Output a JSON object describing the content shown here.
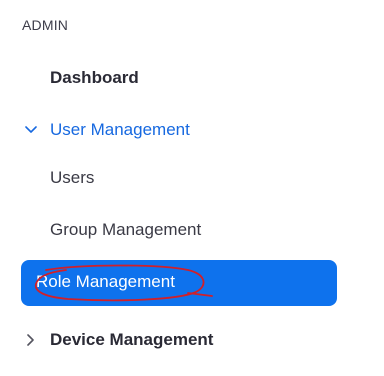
{
  "sidebar": {
    "section_title": "ADMIN",
    "items": [
      {
        "label": "Dashboard"
      },
      {
        "label": "User Management"
      },
      {
        "label": "Users"
      },
      {
        "label": "Group Management"
      },
      {
        "label": "Role Management"
      },
      {
        "label": "Device Management"
      }
    ]
  },
  "colors": {
    "accent": "#0e72ed",
    "expanded_text": "#1769e0",
    "annotation_ink": "#d0202a"
  },
  "icons": {
    "expanded": "chevron-down-icon",
    "collapsed": "chevron-right-icon"
  }
}
